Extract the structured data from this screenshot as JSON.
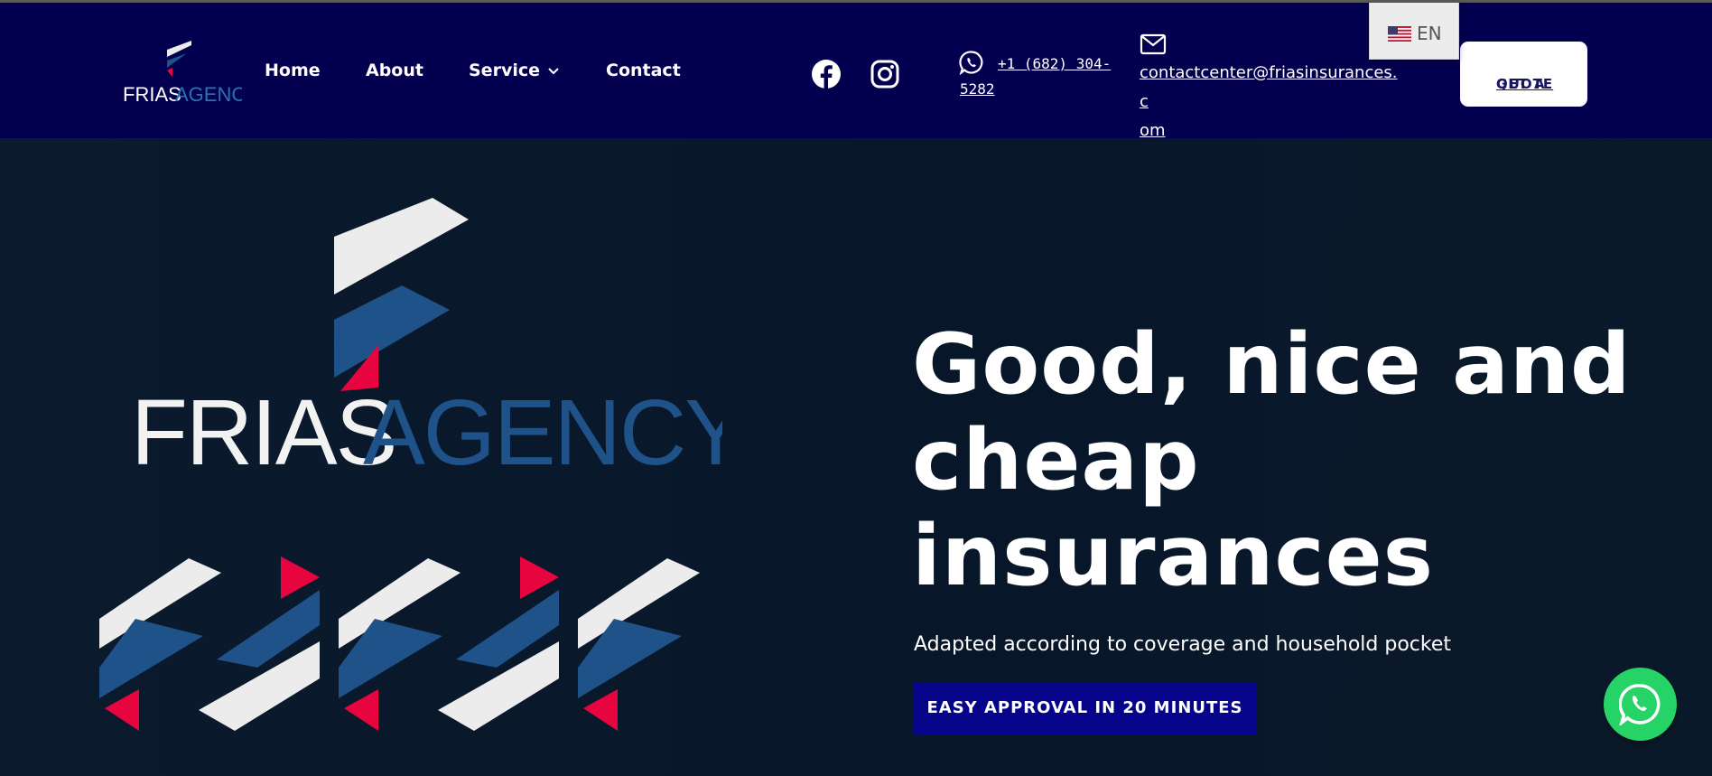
{
  "brand": {
    "logo_part1": "FRIAS",
    "logo_part2": "AGENCY",
    "colors": {
      "navy": "#03014f",
      "blue": "#1e5288",
      "red": "#e8043f",
      "white": "#ffffff"
    }
  },
  "nav": {
    "items": [
      {
        "label": "Home"
      },
      {
        "label": "About"
      },
      {
        "label": "Service",
        "icon": "chevron-down-icon"
      },
      {
        "label": "Contact"
      }
    ]
  },
  "social": [
    {
      "icon": "facebook-icon"
    },
    {
      "icon": "instagram-icon"
    }
  ],
  "contact": {
    "phone_line1": "+1 (682) 304-",
    "phone_line2": "5282",
    "phone_icon": "whatsapp-icon",
    "email_line1": "contactcenter@friasinsurances.c",
    "email_line2": "om",
    "email_icon": "mail-icon"
  },
  "language": {
    "code": "EN",
    "icon": "us-flag-icon"
  },
  "header_button": {
    "line1": "GET A",
    "line2": "QUOTE"
  },
  "hero": {
    "headline_line1": "Good, nice and",
    "headline_line2": "cheap",
    "headline_line3": "insurances",
    "subheadline": "Adapted according to coverage and household pocket",
    "cta_label": "EASY APPROVAL IN 20 MINUTES"
  },
  "floating_button": {
    "icon": "whatsapp-icon",
    "color": "#25d366"
  }
}
